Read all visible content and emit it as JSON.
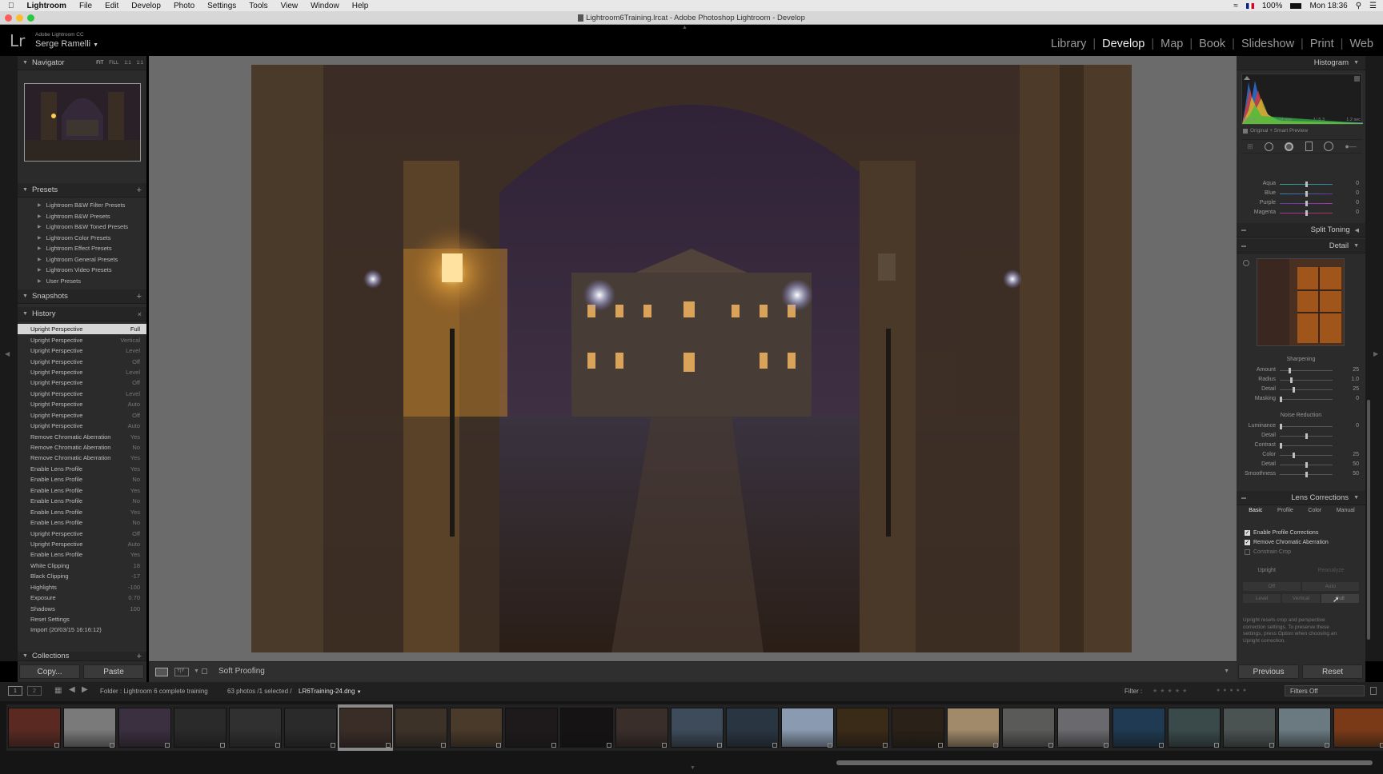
{
  "macos_menu": {
    "app": "Lightroom",
    "items": [
      "File",
      "Edit",
      "Develop",
      "Photo",
      "Settings",
      "Tools",
      "View",
      "Window",
      "Help"
    ],
    "battery": "100%",
    "clock": "Mon 18:36"
  },
  "window_title": "Lightroom6Training.lrcat - Adobe Photoshop Lightroom - Develop",
  "identity": {
    "logo": "Lr",
    "product": "Adobe Lightroom CC",
    "user": "Serge Ramelli"
  },
  "modules": [
    "Library",
    "Develop",
    "Map",
    "Book",
    "Slideshow",
    "Print",
    "Web"
  ],
  "active_module": "Develop",
  "navigator": {
    "title": "Navigator",
    "zoom_options": [
      "FIT",
      "FILL",
      "1:1",
      "1:1"
    ]
  },
  "presets": {
    "title": "Presets",
    "items": [
      "Lightroom B&W Filter Presets",
      "Lightroom B&W Presets",
      "Lightroom B&W Toned Presets",
      "Lightroom Color Presets",
      "Lightroom Effect Presets",
      "Lightroom General Presets",
      "Lightroom Video Presets",
      "User Presets"
    ]
  },
  "snapshots": {
    "title": "Snapshots"
  },
  "history": {
    "title": "History",
    "items": [
      {
        "label": "Upright Perspective",
        "value": "Full"
      },
      {
        "label": "Upright Perspective",
        "value": "Vertical"
      },
      {
        "label": "Upright Perspective",
        "value": "Level"
      },
      {
        "label": "Upright Perspective",
        "value": "Off"
      },
      {
        "label": "Upright Perspective",
        "value": "Level"
      },
      {
        "label": "Upright Perspective",
        "value": "Off"
      },
      {
        "label": "Upright Perspective",
        "value": "Level"
      },
      {
        "label": "Upright Perspective",
        "value": "Auto"
      },
      {
        "label": "Upright Perspective",
        "value": "Off"
      },
      {
        "label": "Upright Perspective",
        "value": "Auto"
      },
      {
        "label": "Remove Chromatic Aberration",
        "value": "Yes"
      },
      {
        "label": "Remove Chromatic Aberration",
        "value": "No"
      },
      {
        "label": "Remove Chromatic Aberration",
        "value": "Yes"
      },
      {
        "label": "Enable Lens Profile",
        "value": "Yes"
      },
      {
        "label": "Enable Lens Profile",
        "value": "No"
      },
      {
        "label": "Enable Lens Profile",
        "value": "Yes"
      },
      {
        "label": "Enable Lens Profile",
        "value": "No"
      },
      {
        "label": "Enable Lens Profile",
        "value": "Yes"
      },
      {
        "label": "Enable Lens Profile",
        "value": "No"
      },
      {
        "label": "Upright Perspective",
        "value": "Off"
      },
      {
        "label": "Upright Perspective",
        "value": "Auto"
      },
      {
        "label": "Enable Lens Profile",
        "value": "Yes"
      },
      {
        "label": "White Clipping",
        "value": "18"
      },
      {
        "label": "Black Clipping",
        "value": "-17"
      },
      {
        "label": "Highlights",
        "value": "-100"
      },
      {
        "label": "Exposure",
        "value": "0.70"
      },
      {
        "label": "Shadows",
        "value": "100"
      },
      {
        "label": "Reset Settings",
        "value": ""
      },
      {
        "label": "Import (20/03/15 16:16:12)",
        "value": ""
      }
    ]
  },
  "collections": {
    "title": "Collections"
  },
  "left_buttons": {
    "copy": "Copy...",
    "paste": "Paste"
  },
  "toolbar": {
    "soft_proofing": "Soft Proofing"
  },
  "histogram": {
    "title": "Histogram",
    "iso": "ISO 80",
    "focal": "24 mm",
    "aperture": "f / 6.3",
    "shutter": "1.2 sec",
    "preview_label": "Original + Smart Preview"
  },
  "hsl_sliders": [
    {
      "label": "Aqua",
      "value": "0"
    },
    {
      "label": "Blue",
      "value": "0"
    },
    {
      "label": "Purple",
      "value": "0"
    },
    {
      "label": "Magenta",
      "value": "0"
    }
  ],
  "split_toning": {
    "title": "Split Toning"
  },
  "detail": {
    "title": "Detail",
    "sharpening_title": "Sharpening",
    "sharpening": [
      {
        "label": "Amount",
        "value": "25"
      },
      {
        "label": "Radius",
        "value": "1.0"
      },
      {
        "label": "Detail",
        "value": "25"
      },
      {
        "label": "Masking",
        "value": "0"
      }
    ],
    "noise_title": "Noise Reduction",
    "noise": [
      {
        "label": "Luminance",
        "value": "0"
      },
      {
        "label": "Detail",
        "value": ""
      },
      {
        "label": "Contrast",
        "value": ""
      },
      {
        "label": "Color",
        "value": "25"
      },
      {
        "label": "Detail",
        "value": "50"
      },
      {
        "label": "Smoothness",
        "value": "50"
      }
    ]
  },
  "lens": {
    "title": "Lens Corrections",
    "tabs": [
      "Basic",
      "Profile",
      "Color",
      "Manual"
    ],
    "checks": [
      {
        "label": "Enable Profile Corrections",
        "checked": true
      },
      {
        "label": "Remove Chromatic Aberration",
        "checked": true
      },
      {
        "label": "Constrain Crop",
        "checked": false
      }
    ],
    "upright_label": "Upright",
    "reanalyze": "Reanalyze",
    "upright_buttons": [
      "Off",
      "Auto",
      "Level",
      "Vertical",
      "Full"
    ],
    "info": "Upright resets crop and perspective correction settings. To preserve these settings, press Option when choosing an Upright correction."
  },
  "right_buttons": {
    "previous": "Previous",
    "reset": "Reset"
  },
  "filmbar": {
    "source": "Folder : Lightroom 6 complete training",
    "count": "63 photos /1 selected /",
    "filename": "LR6Training-24.dng",
    "filter_label": "Filter :",
    "filter_value": "Filters Off",
    "screen_nums": [
      "1",
      "2"
    ]
  },
  "thumbs": {
    "colors": [
      "#5a2a22",
      "#7a7a7a",
      "#3a3040",
      "#2a2a2a",
      "#303030",
      "#2a2a2a",
      "#3a2d28",
      "#3d3228",
      "#4a3a2a",
      "#1e1a1c",
      "#151313",
      "#3a2e2a",
      "#3d4b5a",
      "#2a3542",
      "#8a9ab0",
      "#3a2a18",
      "#2a2118",
      "#a08a6a",
      "#5a5a58",
      "#6a6a6e",
      "#1f3a52",
      "#3a4a4a",
      "#4a5252",
      "#6a7a80",
      "#7a3a18"
    ],
    "selected_index": 6
  }
}
